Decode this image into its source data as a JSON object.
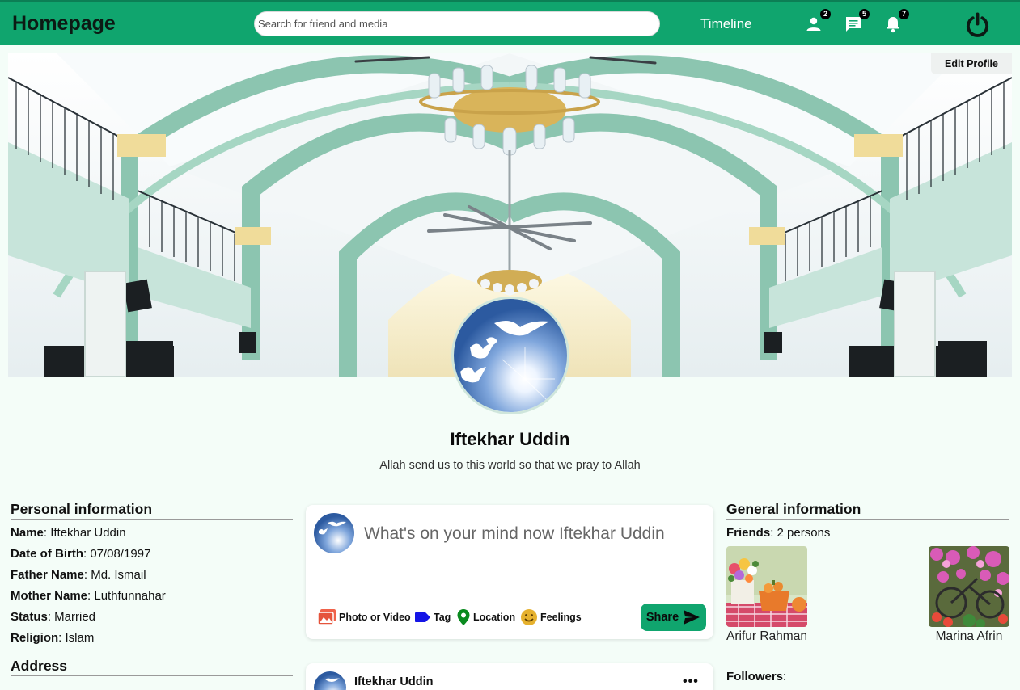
{
  "header": {
    "brand": "Homepage",
    "search_placeholder": "Search for friend and media",
    "timeline": "Timeline",
    "friend_requests": "2",
    "messages": "5",
    "notifications": "7",
    "accent": "#10a56e"
  },
  "cover": {
    "edit_profile": "Edit Profile"
  },
  "profile": {
    "name": "Iftekhar Uddin",
    "bio": "Allah send us to this world so that we pray to Allah"
  },
  "personal": {
    "title": "Personal information",
    "rows": [
      {
        "label": "Name",
        "value": ": Iftekhar Uddin"
      },
      {
        "label": "Date of Birth",
        "value": ": 07/08/1997"
      },
      {
        "label": "Father Name",
        "value": ": Md. Ismail"
      },
      {
        "label": "Mother Name",
        "value": ": Luthfunnahar"
      },
      {
        "label": "Status",
        "value": ": Married"
      },
      {
        "label": "Religion",
        "value": ": Islam"
      }
    ],
    "address_title": "Address"
  },
  "composer": {
    "placeholder": "What's on your mind now Iftekhar Uddin",
    "actions": [
      "Photo or Video",
      "Tag",
      "Location",
      "Feelings"
    ],
    "share": "Share"
  },
  "feed": {
    "author": "Iftekhar Uddin",
    "more": "•••"
  },
  "general": {
    "title": "General information",
    "friends_label": "Friends",
    "friends_value": ": 2 persons",
    "friends": [
      {
        "name": "Arifur Rahman"
      },
      {
        "name": "Marina Afrin"
      }
    ],
    "followers_label": "Followers",
    "followers_value": ":"
  }
}
